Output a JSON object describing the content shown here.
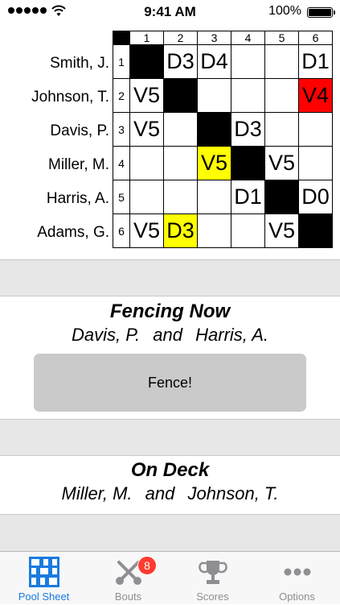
{
  "status_bar": {
    "time": "9:41 AM",
    "battery": "100%"
  },
  "pool": {
    "column_numbers": [
      "1",
      "2",
      "3",
      "4",
      "5",
      "6"
    ],
    "fencers": [
      {
        "name": "Smith, J.",
        "number": "1",
        "results": [
          "",
          "D3",
          "D4",
          "",
          "",
          "D1"
        ]
      },
      {
        "name": "Johnson, T.",
        "number": "2",
        "results": [
          "V5",
          "",
          "",
          "",
          "",
          "V4"
        ]
      },
      {
        "name": "Davis, P.",
        "number": "3",
        "results": [
          "V5",
          "",
          "",
          "D3",
          "",
          ""
        ]
      },
      {
        "name": "Miller, M.",
        "number": "4",
        "results": [
          "",
          "",
          "V5",
          "",
          "V5",
          ""
        ]
      },
      {
        "name": "Harris, A.",
        "number": "5",
        "results": [
          "",
          "",
          "",
          "D1",
          "",
          "D0"
        ]
      },
      {
        "name": "Adams, G.",
        "number": "6",
        "results": [
          "V5",
          "D3",
          "",
          "",
          "V5",
          ""
        ]
      }
    ],
    "highlight_colors": {
      "current_bout": "#ffff00",
      "latest_result": "#ff0000"
    }
  },
  "fencing_now": {
    "heading": "Fencing Now",
    "fencer_a": "Davis, P.",
    "and": "and",
    "fencer_b": "Harris, A.",
    "button_label": "Fence!"
  },
  "on_deck": {
    "heading": "On Deck",
    "fencer_a": "Miller, M.",
    "and": "and",
    "fencer_b": "Johnson, T."
  },
  "tab_bar": {
    "accent_color": "#1a7be0",
    "tabs": [
      {
        "label": "Pool Sheet",
        "icon": "pool-sheet-icon",
        "active": true
      },
      {
        "label": "Bouts",
        "icon": "crossed-swords-icon",
        "badge": "8"
      },
      {
        "label": "Scores",
        "icon": "trophy-icon"
      },
      {
        "label": "Options",
        "icon": "more-dots-icon"
      }
    ]
  }
}
